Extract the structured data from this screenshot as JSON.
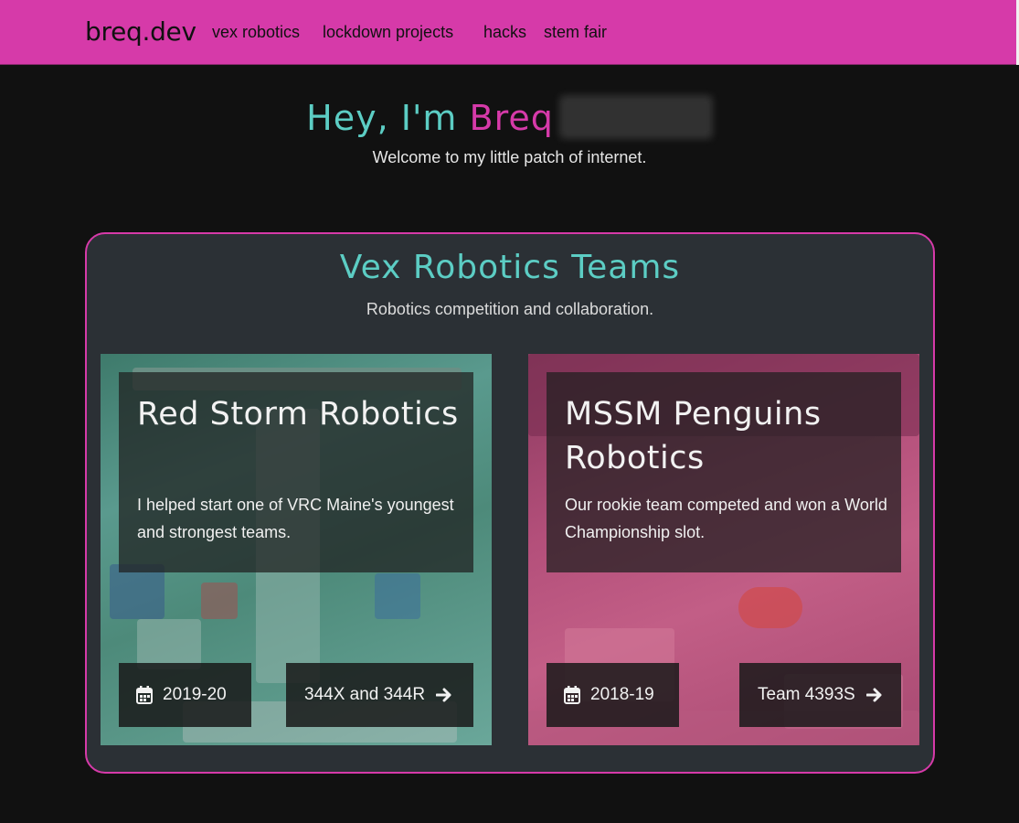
{
  "nav": {
    "brand": "breq.dev",
    "links": [
      "vex robotics",
      "lockdown projects",
      "hacks",
      "stem fair"
    ]
  },
  "hero": {
    "greeting": "Hey, I'm ",
    "name": "Breq",
    "subtitle": "Welcome to my little patch of internet."
  },
  "section": {
    "title": "Vex Robotics Teams",
    "subtitle": "Robotics competition and collaboration."
  },
  "cards": [
    {
      "title": "Red Storm Robotics",
      "description": "I helped start one of VRC Maine's youngest and strongest teams.",
      "year": "2019-20",
      "link_label": "344X and 344R"
    },
    {
      "title": "MSSM Penguins Robotics",
      "description": "Our rookie team competed and won a World Championship slot.",
      "year": "2018-19",
      "link_label": "Team 4393S"
    }
  ],
  "icons": {
    "date": "calendar-icon",
    "link": "arrow-right-icon"
  },
  "colors": {
    "accent_pink": "#d63aa9",
    "accent_teal": "#5ccdc4",
    "background": "#111111",
    "panel": "#2b3035"
  }
}
